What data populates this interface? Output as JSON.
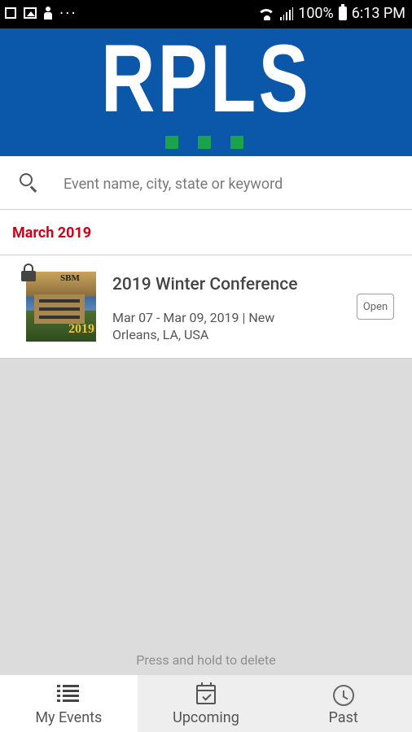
{
  "status_bar": {
    "notification_icons": [
      "flipboard-icon",
      "image-icon",
      "person-icon"
    ],
    "overflow_dots": "···",
    "battery_percent": "100%",
    "time": "6:13 PM"
  },
  "brand": {
    "logo_text": "RPLS",
    "colors": {
      "background": "#0b58aa",
      "accent_squares": "#1aa34a"
    }
  },
  "search": {
    "placeholder": "Event name, city, state or keyword",
    "value": ""
  },
  "section": {
    "month_label": "March 2019",
    "month_color": "#d0021b"
  },
  "events": [
    {
      "title": "2019 Winter Conference",
      "dates": "Mar 07  -  Mar 09, 2019 | New Orleans, LA, USA",
      "thumbnail_text_top": "SBM",
      "thumbnail_text_year": "2019",
      "locked": true,
      "action_label": "Open"
    }
  ],
  "hint": "Press and hold to delete",
  "tabs": [
    {
      "label": "My Events",
      "icon": "list-icon",
      "active": true
    },
    {
      "label": "Upcoming",
      "icon": "calendar-check-icon",
      "active": false
    },
    {
      "label": "Past",
      "icon": "clock-icon",
      "active": false
    }
  ]
}
